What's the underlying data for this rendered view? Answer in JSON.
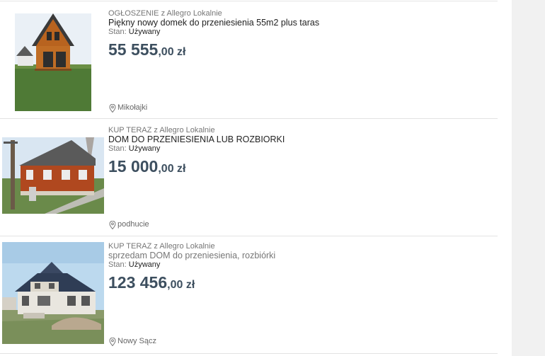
{
  "listings": [
    {
      "meta": "OGŁOSZENIE z Allegro Lokalnie",
      "title": "Piękny nowy domek do przeniesienia 55m2 plus taras",
      "condition_label": "Stan:",
      "condition_value": "Używany",
      "price_main": "55 555",
      "price_fraction": ",00 zł",
      "location": "Mikołajki",
      "location_icon": "map-pin-icon"
    },
    {
      "meta": "KUP TERAZ z Allegro Lokalnie",
      "title": "DOM DO PRZENIESIENIA LUB ROZBIORKI",
      "condition_label": "Stan:",
      "condition_value": "Używany",
      "price_main": "15 000",
      "price_fraction": ",00 zł",
      "location": "podhucie",
      "location_icon": "map-pin-icon"
    },
    {
      "meta": "KUP TERAZ z Allegro Lokalnie",
      "title": "sprzedam DOM do przeniesienia, rozbiórki",
      "condition_label": "Stan:",
      "condition_value": "Używany",
      "price_main": "123 456",
      "price_fraction": ",00 zł",
      "location": "Nowy Sącz",
      "location_icon": "map-pin-icon"
    }
  ],
  "colors": {
    "price": "#3d4f5f",
    "meta": "#767676",
    "divider": "#e3e3e3",
    "panel": "#f1f1f1"
  }
}
